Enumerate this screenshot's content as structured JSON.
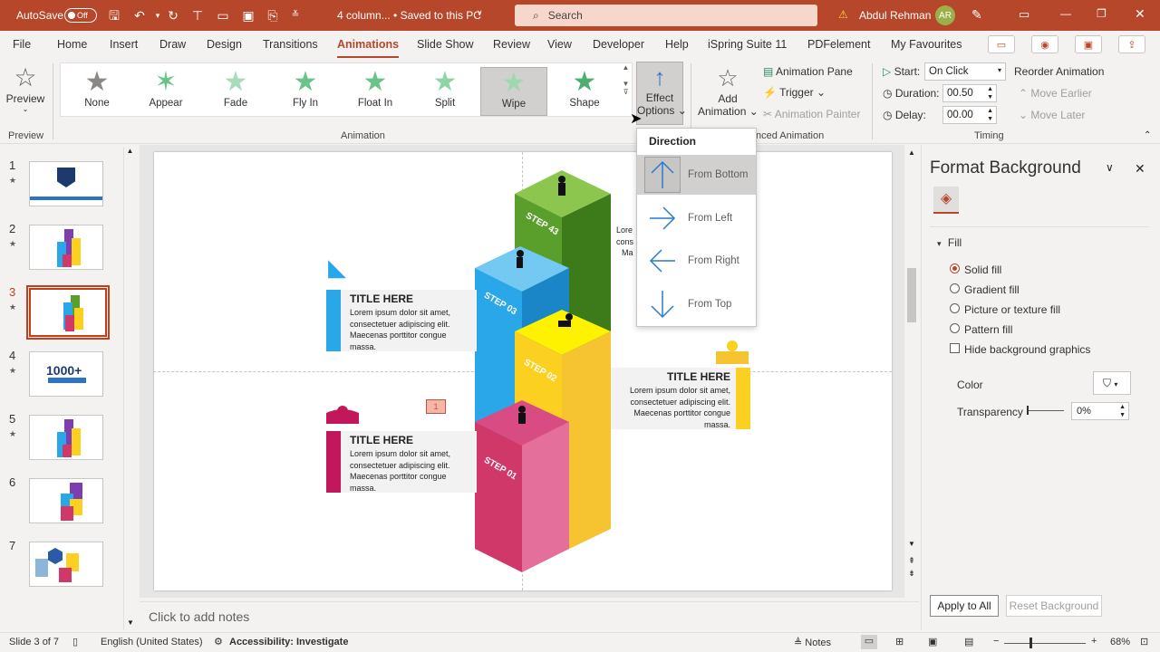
{
  "titlebar": {
    "autosave_label": "AutoSave",
    "autosave_state": "Off",
    "doc_title": "4 column... • Saved to this PC",
    "search_placeholder": "Search",
    "user_name": "Abdul Rehman",
    "user_initials": "AR"
  },
  "tabs": [
    "File",
    "Home",
    "Insert",
    "Draw",
    "Design",
    "Transitions",
    "Animations",
    "Slide Show",
    "Review",
    "View",
    "Developer",
    "Help",
    "iSpring Suite 11",
    "PDFelement",
    "My Favourites"
  ],
  "ribbon": {
    "preview": {
      "label": "Preview",
      "group": "Preview"
    },
    "animations": [
      "None",
      "Appear",
      "Fade",
      "Fly In",
      "Float In",
      "Split",
      "Wipe",
      "Shape"
    ],
    "selected_animation": "Wipe",
    "group_animation": "Animation",
    "effect_options": [
      "Effect",
      "Options"
    ],
    "add_animation": [
      "Add",
      "Animation"
    ],
    "animation_pane": "Animation Pane",
    "trigger": "Trigger",
    "animation_painter": "Animation Painter",
    "group_advanced": "nced Animation",
    "start_label": "Start:",
    "start_value": "On Click",
    "duration_label": "Duration:",
    "duration_value": "00.50",
    "delay_label": "Delay:",
    "delay_value": "00.00",
    "reorder": "Reorder Animation",
    "move_earlier": "Move Earlier",
    "move_later": "Move Later",
    "group_timing": "Timing"
  },
  "direction_menu": {
    "header": "Direction",
    "items": [
      "From Bottom",
      "From Left",
      "From Right",
      "From Top"
    ],
    "selected": "From Bottom"
  },
  "slides": [
    "1",
    "2",
    "3",
    "4",
    "5",
    "6",
    "7"
  ],
  "selected_slide": "3",
  "slide": {
    "title1": "TITLE HERE",
    "body1": "Lorem ipsum dolor sit amet, consectetuer adipiscing elit. Maecenas porttitor congue massa.",
    "title2": "TITLE HERE",
    "body2": "Lorem ipsum dolor sit amet, consectetuer adipiscing elit. Maecenas porttitor congue massa.",
    "title3": "TITLE HERE",
    "body3": "Lorem ipsum dolor sit amet, consectetuer adipiscing elit. Maecenas porttitor congue massa.",
    "partial_text": [
      "Lore",
      "cons",
      "Ma"
    ],
    "anim_tag": "1",
    "steps": [
      "STEP 01",
      "STEP 02",
      "STEP 03",
      "STEP 43"
    ]
  },
  "format_pane": {
    "title": "Format Background",
    "section": "Fill",
    "options": [
      "Solid fill",
      "Gradient fill",
      "Picture or texture fill",
      "Pattern fill"
    ],
    "selected_option": "Solid fill",
    "hide_bg": "Hide background graphics",
    "color_label": "Color",
    "transparency_label": "Transparency",
    "transparency_value": "0%",
    "apply_all": "Apply to All",
    "reset_bg": "Reset Background"
  },
  "notes_placeholder": "Click to add notes",
  "status": {
    "slide_info": "Slide 3 of 7",
    "language": "English (United States)",
    "accessibility": "Accessibility: Investigate",
    "notes": "Notes",
    "zoom": "68%"
  },
  "colors": {
    "accent": "#b7472a",
    "step1": "#d0386a",
    "step2": "#fbd020",
    "step3": "#29a7e8",
    "step4": "#5a9e2c"
  }
}
